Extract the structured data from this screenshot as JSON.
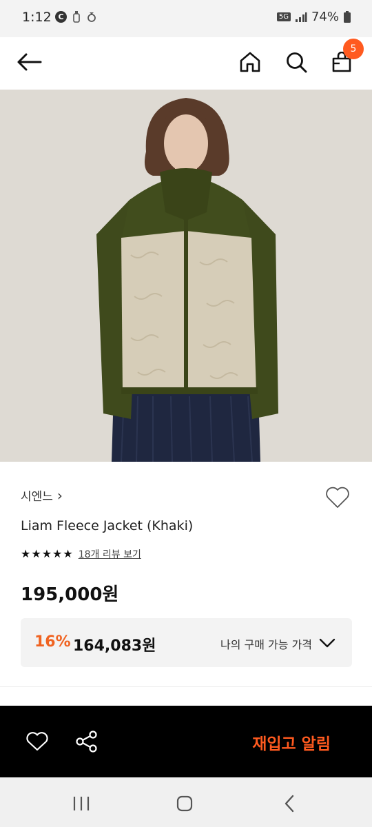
{
  "status_bar": {
    "time": "1:12",
    "battery": "74%",
    "network": "5G"
  },
  "header": {
    "cart_count": "5",
    "icons": [
      "back-arrow-icon",
      "home-icon",
      "search-icon",
      "cart-icon"
    ]
  },
  "product": {
    "brand": "시엔느",
    "brand_chevron": "›",
    "name": "Liam Fleece Jacket (Khaki)",
    "rating_stars": 5,
    "review_link": "18개 리뷰 보기",
    "price": "195,000원",
    "discount": {
      "rate": "16%",
      "price": "164,083원",
      "label": "나의 구매 가능 가격"
    }
  },
  "action_bar": {
    "restock_label": "재입고 알림"
  },
  "colors": {
    "accent": "#ff5a1f",
    "discount": "#f06321",
    "jacket_khaki": "#3f4a1c",
    "fleece": "#d6cdb8"
  }
}
